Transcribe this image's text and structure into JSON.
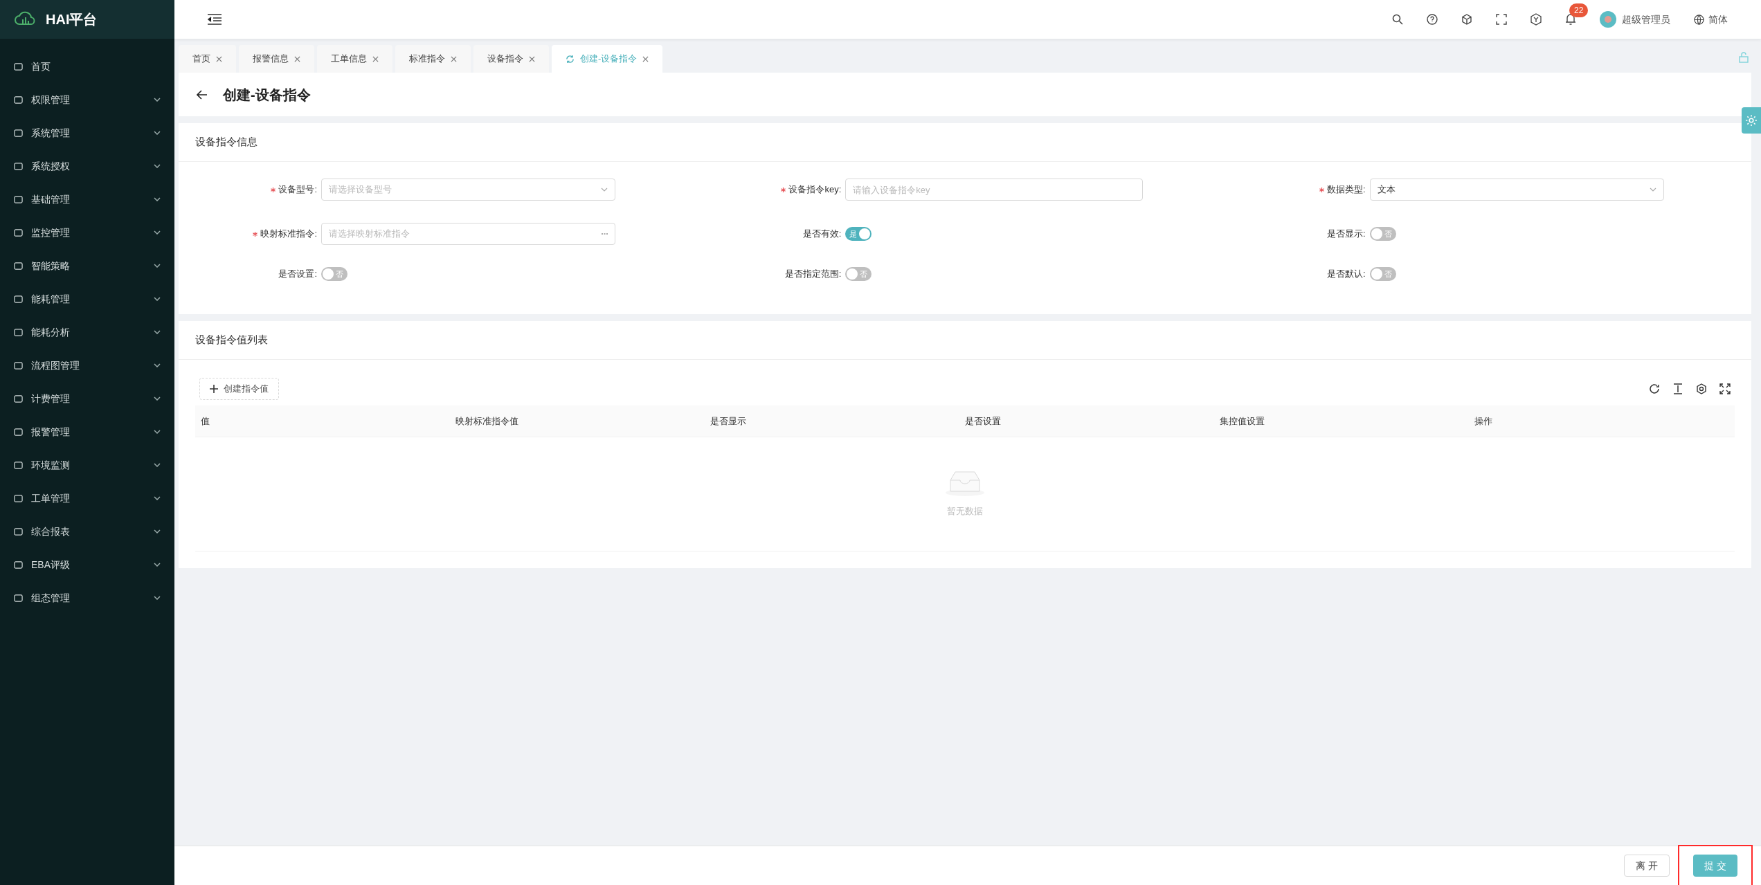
{
  "brand": {
    "title": "HAI平台"
  },
  "sidebar": {
    "items": [
      {
        "label": "首页",
        "expandable": false
      },
      {
        "label": "权限管理",
        "expandable": true
      },
      {
        "label": "系统管理",
        "expandable": true
      },
      {
        "label": "系统授权",
        "expandable": true
      },
      {
        "label": "基础管理",
        "expandable": true
      },
      {
        "label": "监控管理",
        "expandable": true
      },
      {
        "label": "智能策略",
        "expandable": true
      },
      {
        "label": "能耗管理",
        "expandable": true
      },
      {
        "label": "能耗分析",
        "expandable": true
      },
      {
        "label": "流程图管理",
        "expandable": true
      },
      {
        "label": "计费管理",
        "expandable": true
      },
      {
        "label": "报警管理",
        "expandable": true
      },
      {
        "label": "环境监测",
        "expandable": true
      },
      {
        "label": "工单管理",
        "expandable": true
      },
      {
        "label": "综合报表",
        "expandable": true
      },
      {
        "label": "EBA评级",
        "expandable": true
      },
      {
        "label": "组态管理",
        "expandable": true
      }
    ]
  },
  "header": {
    "notification_count": "22",
    "user": "超级管理员",
    "language": "简体"
  },
  "tabs": [
    {
      "label": "首页",
      "selected": false
    },
    {
      "label": "报警信息",
      "selected": false
    },
    {
      "label": "工单信息",
      "selected": false
    },
    {
      "label": "标准指令",
      "selected": false
    },
    {
      "label": "设备指令",
      "selected": false
    },
    {
      "label": "创建-设备指令",
      "selected": true
    }
  ],
  "page_title": "创建-设备指令",
  "info_section": {
    "title": "设备指令信息",
    "fields": [
      {
        "kind": "select",
        "label": "设备型号:",
        "required": true,
        "placeholder": "请选择设备型号"
      },
      {
        "kind": "input",
        "label": "设备指令key:",
        "required": true,
        "placeholder": "请输入设备指令key"
      },
      {
        "kind": "select",
        "label": "数据类型:",
        "required": true,
        "value": "文本"
      },
      {
        "kind": "picker",
        "label": "映射标准指令:",
        "required": true,
        "placeholder": "请选择映射标准指令"
      },
      {
        "kind": "switch",
        "label": "是否有效:",
        "required": false,
        "on": true,
        "text": "是"
      },
      {
        "kind": "switch",
        "label": "是否显示:",
        "required": false,
        "on": false,
        "text": "否"
      },
      {
        "kind": "switch",
        "label": "是否设置:",
        "required": false,
        "on": false,
        "text": "否"
      },
      {
        "kind": "switch",
        "label": "是否指定范围:",
        "required": false,
        "on": false,
        "text": "否"
      },
      {
        "kind": "switch",
        "label": "是否默认:",
        "required": false,
        "on": false,
        "text": "否"
      }
    ]
  },
  "values_section": {
    "title": "设备指令值列表",
    "create_button": "创建指令值",
    "table": {
      "columns": [
        "值",
        "映射标准指令值",
        "是否显示",
        "是否设置",
        "集控值设置",
        "操作"
      ],
      "empty_text": "暂无数据"
    }
  },
  "footer": {
    "buttons": [
      {
        "label": "离 开",
        "kind": "secondary"
      },
      {
        "label": "提 交",
        "kind": "primary"
      }
    ]
  }
}
